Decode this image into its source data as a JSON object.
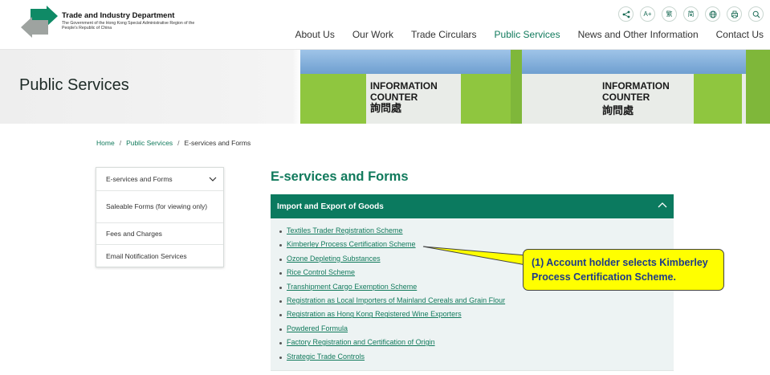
{
  "header": {
    "dept_name": "Trade and Industry Department",
    "dept_sub": "The Government of the Hong Kong Special Administrative Region of the People's Republic of China",
    "icons": [
      "share-icon",
      "font-size-icon",
      "traditional-chinese-icon",
      "simplified-chinese-icon",
      "globe-icon",
      "print-icon",
      "search-icon"
    ],
    "icon_glyphs": [
      "<",
      "A+",
      "繁",
      "简",
      "◍",
      "▭",
      "⌕"
    ],
    "nav": [
      "About Us",
      "Our Work",
      "Trade Circulars",
      "Public Services",
      "News and Other Information",
      "Contact Us"
    ],
    "nav_active": "Public Services"
  },
  "hero": {
    "title": "Public Services",
    "photo_text_en": "INFORMATION COUNTER",
    "photo_text_cn": "詢問處"
  },
  "breadcrumb": {
    "items": [
      "Home",
      "Public Services",
      "E-services and Forms"
    ],
    "sep": "/"
  },
  "sidebar": {
    "items": [
      "E-services and Forms",
      "Saleable Forms (for viewing only)",
      "Fees and Charges",
      "Email Notification Services"
    ]
  },
  "main": {
    "title": "E-services and Forms",
    "accordion_title": "Import and Export of Goods",
    "links": [
      "Textiles Trader Registration Scheme",
      "Kimberley Process Certification Scheme",
      "Ozone Depleting Substances",
      "Rice Control Scheme",
      "Transhipment Cargo Exemption Scheme",
      "Registration as Local Importers of Mainland Cereals and Grain Flour",
      "Registration as Hong Kong Registered Wine Exporters",
      "Powdered Formula",
      "Factory Registration and Certification of Origin",
      "Strategic Trade Controls"
    ]
  },
  "callout": {
    "text": "(1) Account holder selects Kimberley Process Certification Scheme."
  },
  "colors": {
    "brand_green": "#117a5c",
    "accordion_bg": "#0b7a5f",
    "callout_bg": "#ffff00",
    "callout_text": "#1d3a8a"
  }
}
